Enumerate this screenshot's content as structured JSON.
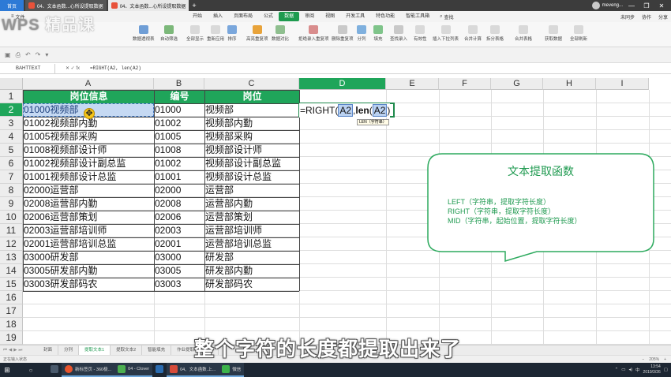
{
  "titlebar": {
    "home": "首页",
    "tabs": [
      {
        "label": "04、文本函数...心所设提取数据",
        "active": false
      },
      {
        "label": "04、文本函数...心所设提取数据",
        "active": true
      }
    ],
    "user": "meveng...",
    "win_min": "—",
    "win_max": "❐",
    "win_close": "✕"
  },
  "logo": {
    "text": "WPS",
    "suffix": "精品课"
  },
  "ribbon": {
    "file_menu": "文件",
    "tabs": [
      "开始",
      "插入",
      "页面布局",
      "公式",
      "数据",
      "审阅",
      "视图",
      "开发工具",
      "特色功能",
      "智能工具箱"
    ],
    "active_tab": "数据",
    "search": "查找",
    "right": [
      "未同步",
      "协作",
      "分享"
    ],
    "buttons": [
      "数据透视表",
      "自动筛选",
      "全部显示",
      "重新应用",
      "排序",
      "高亮重复项",
      "数据对比",
      "拒绝录入重复项",
      "删除重复项",
      "分列",
      "填充",
      "查找录入",
      "有效性",
      "插入下拉列表",
      "合并计算",
      "模拟分析",
      "记录单",
      "创建组",
      "取消组合",
      "分类汇总",
      "展开明细",
      "折叠明细",
      "拆分表格",
      "合并表格",
      "获取数据",
      "全部刷新"
    ]
  },
  "formula_bar": {
    "name_box": "BAHTTEXT",
    "fx": "✕ ✓ fx",
    "formula": "=RIGHT(A2, len(A2)"
  },
  "grid": {
    "columns": [
      "A",
      "B",
      "C",
      "D",
      "E",
      "F",
      "G",
      "H",
      "I"
    ],
    "selected_column": "D",
    "rows": [
      "1",
      "2",
      "3",
      "4",
      "5",
      "6",
      "7",
      "8",
      "9",
      "10",
      "11",
      "12",
      "13",
      "14",
      "15",
      "16",
      "17",
      "18",
      "19"
    ],
    "selected_row": "2",
    "headers": [
      "岗位信息",
      "编号",
      "岗位"
    ],
    "data": [
      [
        "01000视频部",
        "01000",
        "视频部"
      ],
      [
        "01002视频部内勤",
        "01002",
        "视频部内勤"
      ],
      [
        "01005视频部采购",
        "01005",
        "视频部采购"
      ],
      [
        "01008视频部设计师",
        "01008",
        "视频部设计师"
      ],
      [
        "01002视频部设计副总监",
        "01002",
        "视频部设计副总监"
      ],
      [
        "01001视频部设计总监",
        "01001",
        "视频部设计总监"
      ],
      [
        "02000运营部",
        "02000",
        "运营部"
      ],
      [
        "02008运营部内勤",
        "02008",
        "运营部内勤"
      ],
      [
        "02006运营部策划",
        "02006",
        "运营部策划"
      ],
      [
        "02003运营部培训师",
        "02003",
        "运营部培训师"
      ],
      [
        "02001运营部培训总监",
        "02001",
        "运营部培训总监"
      ],
      [
        "03000研发部",
        "03000",
        "研发部"
      ],
      [
        "03005研发部内勤",
        "03005",
        "研发部内勤"
      ],
      [
        "03003研发部码农",
        "03003",
        "研发部码农"
      ]
    ],
    "a2_visible": "01000视频部",
    "edit": {
      "prefix": "=RIGHT(",
      "ref1": "A2",
      "sep": ",",
      "fn": "len",
      "open": "(",
      "ref2": "A2",
      "close": ")"
    },
    "tooltip": "LEN（字符串）"
  },
  "callout": {
    "title": "文本提取函数",
    "lines": [
      "LEFT（字符串，提取字符长度）",
      "RIGHT（字符串，提取字符长度）",
      "MID（字符串，起始位置，提取字符长度）"
    ],
    "color": "#1f9a50"
  },
  "sheets": {
    "tabs": [
      "封面",
      "分列",
      "提取文本1",
      "提取文本2",
      "智能填充",
      "作业提取..."
    ],
    "active": "提取文本1",
    "status": "正在输入状态",
    "zoom": "205%"
  },
  "subtitle": "整个字符的长度都提取出来了",
  "taskbar": {
    "apps": [
      "新标签页 - 360极...",
      "04 - Clover",
      "",
      "04、文本函数.上...",
      "微信"
    ],
    "time": "13:54",
    "date": "2019/3/26",
    "lang": "中"
  }
}
